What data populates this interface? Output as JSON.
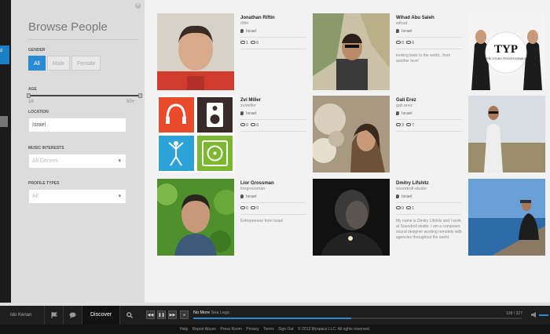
{
  "panel": {
    "title": "Browse People",
    "gender_label": "GENDER",
    "gender_options": [
      "All",
      "Male",
      "Female"
    ],
    "gender_selected": "All",
    "age_label": "AGE",
    "age_min": "18",
    "age_max": "50+",
    "location_label": "LOCATION",
    "location_value": "Israel",
    "music_label": "MUSIC INTERESTS",
    "music_value": "All Genres",
    "profile_label": "PROFILE TYPES",
    "profile_value": "All"
  },
  "edge": {
    "label": "d"
  },
  "people": [
    {
      "name": "Jonathan Riftin",
      "username": "riftin",
      "location": "Israel",
      "count1": "1",
      "count2": "6",
      "bio": ""
    },
    {
      "name": "Wihad Abu Saleh",
      "username": "wihad",
      "location": "Israel",
      "count1": "0",
      "count2": "0",
      "bio": "looking back to the world...from another level"
    },
    {
      "name": "Zvi Miller",
      "username": "zvimiller",
      "location": "Israel",
      "count1": "0",
      "count2": "0",
      "bio": ""
    },
    {
      "name": "Gali Erez",
      "username": "gali erez",
      "location": "Israel",
      "count1": "3",
      "count2": "7",
      "bio": ""
    },
    {
      "name": "Lior Grossman",
      "username": "liorgrossman",
      "location": "Israel",
      "count1": "0",
      "count2": "0",
      "bio": "Entrepreneur from Israel"
    },
    {
      "name": "Dmitry Lifshitz",
      "username": "soundroll-studio",
      "location": "Israel",
      "count1": "0",
      "count2": "1",
      "bio": "My name is Dmitry Lifshitz and I work at Soundroll studio. I am a composer, sound designer working remotely with agencies throughout the world."
    }
  ],
  "tile_logo": {
    "title": "TYP",
    "subtitle": "THE YOUNG PROFESSIONALS"
  },
  "player": {
    "user": "Ido Kenan",
    "discover": "Discover",
    "track_title": "No More",
    "track_artist": "Sea Legs",
    "time": "138 / 327",
    "progress": 0.48
  },
  "footer": [
    "Help",
    "Report Abuse",
    "Press Room",
    "Privacy",
    "Terms",
    "Sign Out",
    "© 2013 Myspace LLC. All rights reserved."
  ],
  "colors": {
    "accent": "#2a8ad4",
    "bar": "#1e1e1e",
    "tile_red": "#ea4b2a",
    "tile_blue": "#2ba3d9",
    "tile_green": "#7cb82f",
    "tile_dark": "#3b2a2a"
  }
}
